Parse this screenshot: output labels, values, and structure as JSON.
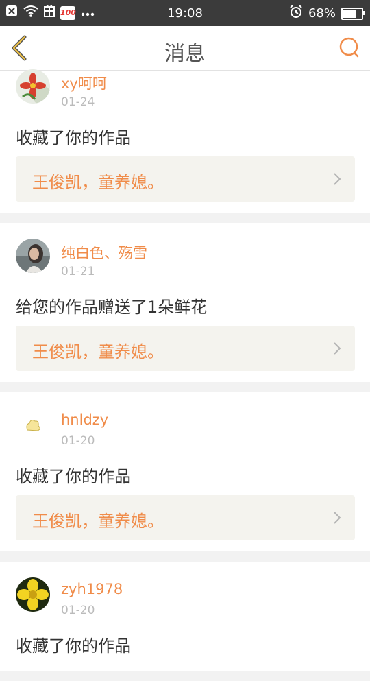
{
  "status_bar": {
    "time": "19:08",
    "battery_text": "68%",
    "battery_level": 0.68,
    "badge": "100",
    "icons": [
      "close-box-icon",
      "wifi-icon",
      "sim-icon",
      "badge-100-icon",
      "more-dots-icon",
      "alarm-icon",
      "battery-icon"
    ]
  },
  "header": {
    "title": "消息",
    "back_icon": "chevron-left-icon",
    "search_icon": "search-icon",
    "accent": "#f08c4a"
  },
  "messages": [
    {
      "user": "xy呵呵",
      "date": "01-24",
      "action": "收藏了你的作品",
      "work": "王俊凯，童养媳。",
      "avatar": "flower-avatar"
    },
    {
      "user": "纯白色、殇雪",
      "date": "01-21",
      "action": "给您的作品赠送了1朵鲜花",
      "work": "王俊凯，童养媳。",
      "avatar": "girl-avatar"
    },
    {
      "user": "hnldzy",
      "date": "01-20",
      "action": "收藏了你的作品",
      "work": "王俊凯，童养媳。",
      "avatar": "default-avatar"
    },
    {
      "user": "zyh1978",
      "date": "01-20",
      "action": "收藏了你的作品",
      "work": "",
      "avatar": "yellow-flower-avatar"
    }
  ],
  "colors": {
    "accent": "#f08c4a",
    "work_bg": "#f4f3ee",
    "date": "#bbbbbb",
    "page_bg": "#f2f2f2"
  }
}
